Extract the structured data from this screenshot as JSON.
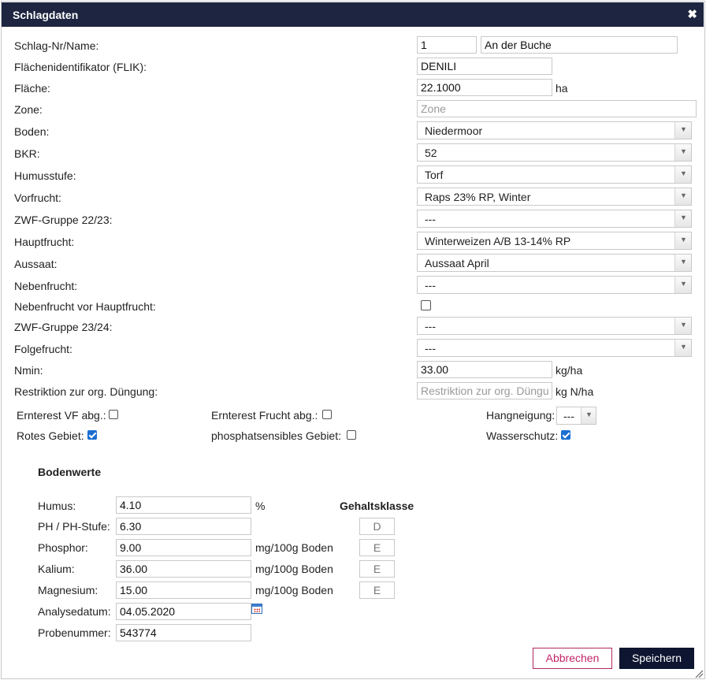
{
  "dialog": {
    "title": "Schlagdaten",
    "close_glyph": "✖"
  },
  "fields": {
    "schlag": {
      "label": "Schlag-Nr/Name:",
      "nr": "1",
      "name": "An der Buche"
    },
    "flik": {
      "label": "Flächenidentifikator (FLIK):",
      "value": "DENILI"
    },
    "flaeche": {
      "label": "Fläche:",
      "value": "22.1000",
      "unit": "ha"
    },
    "zone": {
      "label": "Zone:",
      "value": "",
      "placeholder": "Zone"
    },
    "boden": {
      "label": "Boden:",
      "value": "Niedermoor"
    },
    "bkr": {
      "label": "BKR:",
      "value": "52"
    },
    "humusstufe": {
      "label": "Humusstufe:",
      "value": "Torf"
    },
    "vorfrucht": {
      "label": "Vorfrucht:",
      "value": "Raps 23% RP, Winter"
    },
    "zwf1": {
      "label": "ZWF-Gruppe 22/23:",
      "value": "---"
    },
    "hauptfrucht": {
      "label": "Hauptfrucht:",
      "value": "Winterweizen A/B 13-14% RP"
    },
    "aussaat": {
      "label": "Aussaat:",
      "value": "Aussaat April"
    },
    "nebenfrucht": {
      "label": "Nebenfrucht:",
      "value": "---"
    },
    "nebenfrucht_vor": {
      "label": "Nebenfrucht vor Hauptfrucht:",
      "checked": false
    },
    "zwf2": {
      "label": "ZWF-Gruppe 23/24:",
      "value": "---"
    },
    "folgefrucht": {
      "label": "Folgefrucht:",
      "value": "---"
    },
    "nmin": {
      "label": "Nmin:",
      "value": "33.00",
      "unit": "kg/ha"
    },
    "restriktion": {
      "label": "Restriktion zur org. Düngung:",
      "value": "",
      "placeholder": "Restriktion zur org. Düngung",
      "unit": "kg N/ha"
    }
  },
  "flags": {
    "ernterest_vf": {
      "label": "Ernterest VF abg.:",
      "checked": false
    },
    "ernterest_frucht": {
      "label": "Ernterest Frucht abg.:",
      "checked": false
    },
    "hangneigung": {
      "label": "Hangneigung:",
      "value": "---"
    },
    "rotes_gebiet": {
      "label": "Rotes Gebiet:",
      "checked": true
    },
    "phosphat": {
      "label": "phosphatsensibles Gebiet:",
      "checked": false
    },
    "wasserschutz": {
      "label": "Wasserschutz:",
      "checked": true
    }
  },
  "bodenwerte": {
    "heading": "Bodenwerte",
    "gehaltsklasse_heading": "Gehaltsklasse",
    "humus": {
      "label": "Humus:",
      "value": "4.10",
      "unit": "%"
    },
    "ph": {
      "label": "PH / PH-Stufe:",
      "value": "6.30",
      "klasse": "D"
    },
    "phosphor": {
      "label": "Phosphor:",
      "value": "9.00",
      "unit": "mg/100g Boden",
      "klasse": "E"
    },
    "kalium": {
      "label": "Kalium:",
      "value": "36.00",
      "unit": "mg/100g Boden",
      "klasse": "E"
    },
    "magnesium": {
      "label": "Magnesium:",
      "value": "15.00",
      "unit": "mg/100g Boden",
      "klasse": "E"
    },
    "analysedatum": {
      "label": "Analysedatum:",
      "value": "04.05.2020"
    },
    "probennummer": {
      "label": "Probenummer:",
      "value": "543774"
    }
  },
  "buttons": {
    "cancel": "Abbrechen",
    "save": "Speichern"
  },
  "icons": {
    "calendar": "calendar-icon",
    "close": "close-icon",
    "dropdown": "chevron-down-icon"
  },
  "colors": {
    "titlebar": "#1d2540",
    "checkbox_checked": "#1a6fd0",
    "cancel_accent": "#c2256a",
    "save_bg": "#0d1530"
  }
}
